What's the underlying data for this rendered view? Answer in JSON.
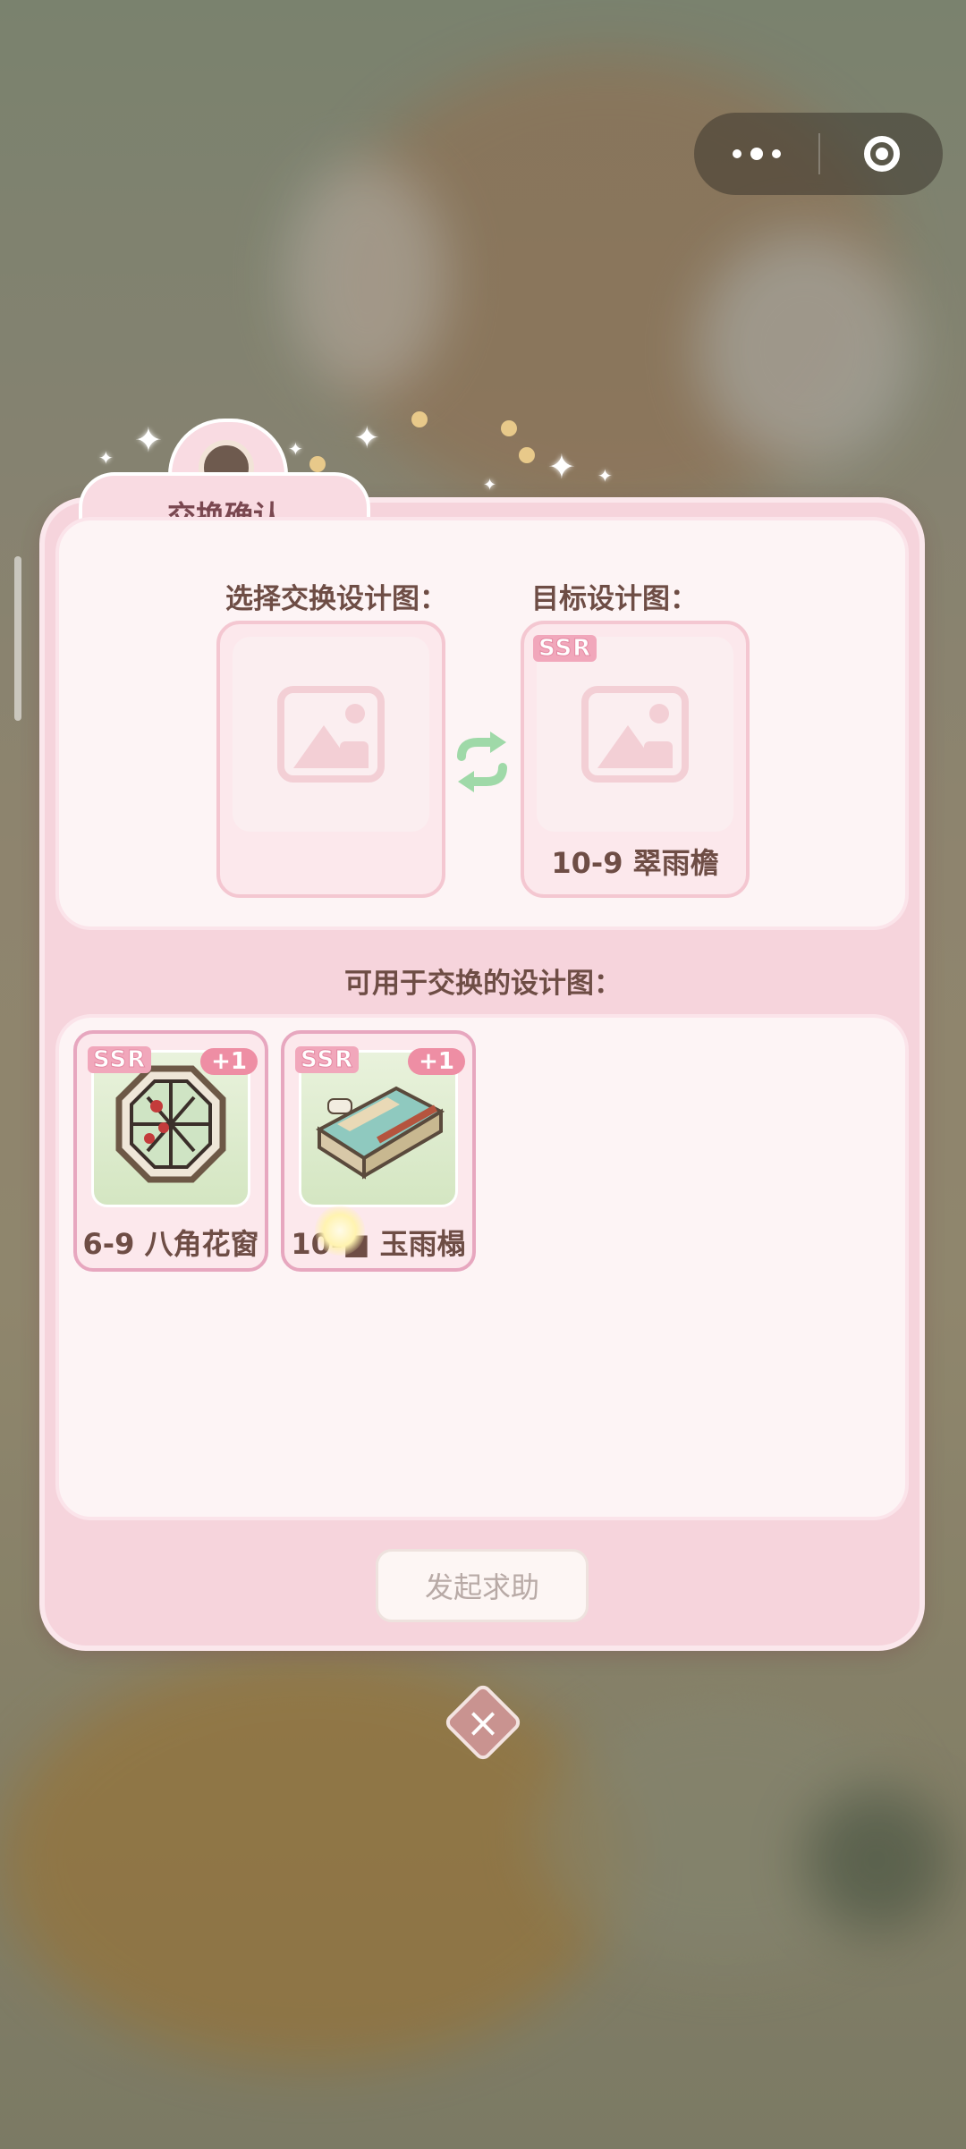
{
  "dialog": {
    "title": "交换确认",
    "select_label": "选择交换设计图：",
    "target_label": "目标设计图：",
    "available_label": "可用于交换的设计图：",
    "help_button": "发起求助"
  },
  "target_card": {
    "rarity": "SSR",
    "name": "10-9 翠雨檐"
  },
  "items": [
    {
      "rarity": "SSR",
      "count": "+1",
      "name": "6-9 八角花窗"
    },
    {
      "rarity": "SSR",
      "count": "+1",
      "name": "10-■ 玉雨榻"
    }
  ],
  "icons": {
    "capsule_more": "more-dots-icon",
    "capsule_close": "target-circle-icon",
    "swap": "swap-arrows-icon",
    "placeholder": "image-placeholder-icon",
    "close": "close-icon"
  },
  "colors": {
    "panel": "#f6d4dc",
    "accent": "#ee8ea4",
    "swap": "#9fd9a8"
  }
}
